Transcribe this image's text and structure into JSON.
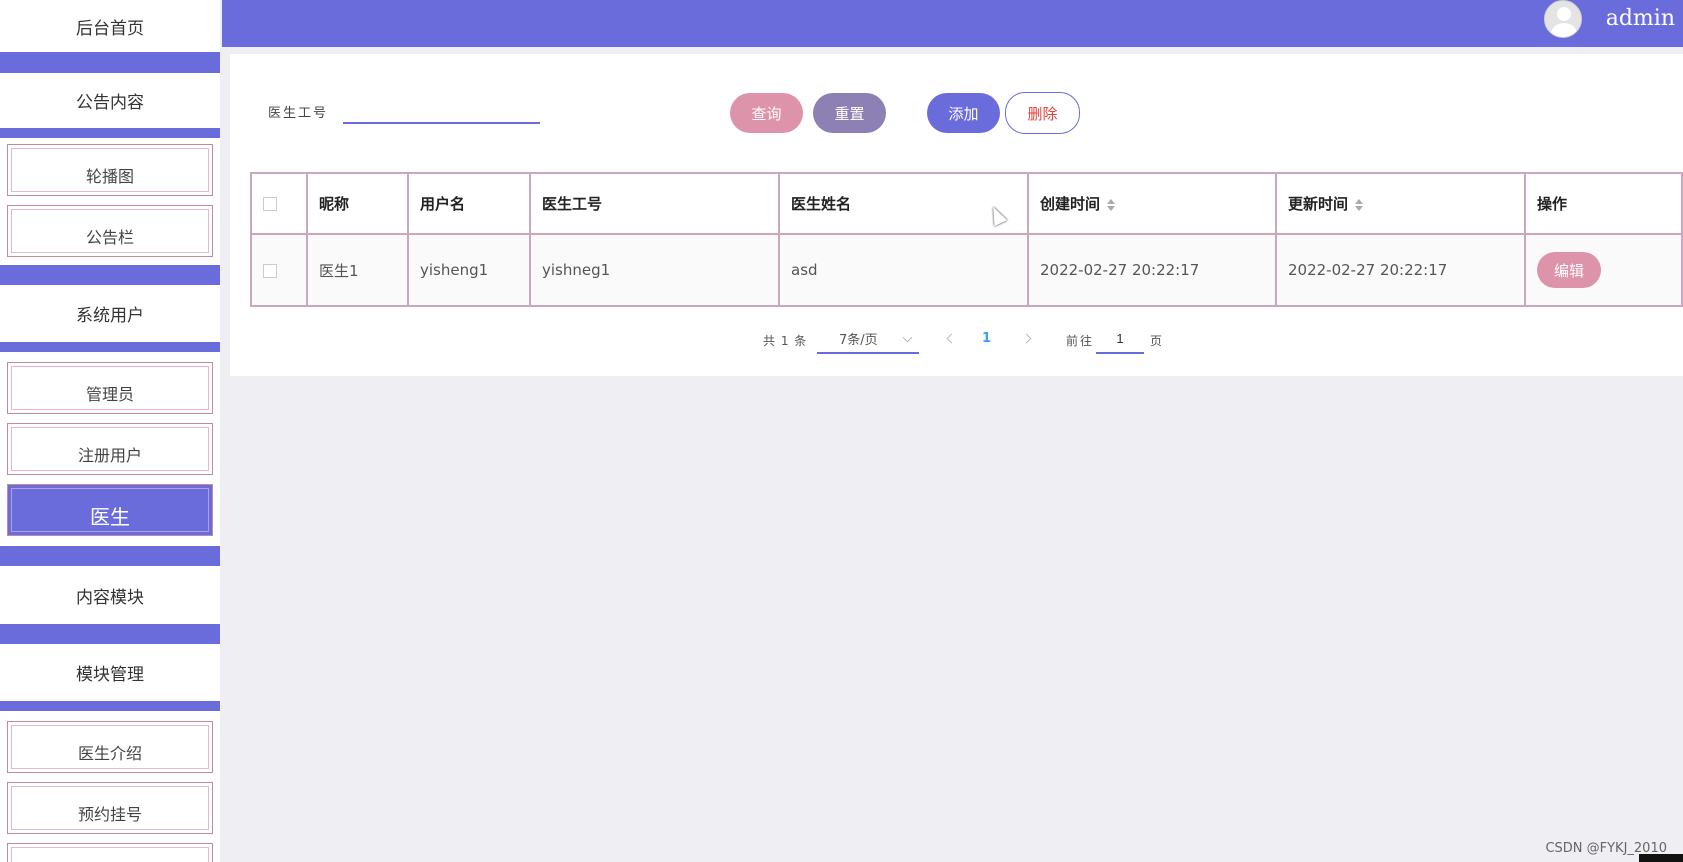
{
  "sidebar": {
    "home": "后台首页",
    "groups": [
      {
        "label": "公告内容",
        "items": [
          "轮播图",
          "公告栏"
        ]
      },
      {
        "label": "系统用户",
        "items": [
          "管理员",
          "注册用户",
          "医生"
        ]
      },
      {
        "label": "内容模块",
        "items": []
      },
      {
        "label": "模块管理",
        "items": [
          "医生介绍",
          "预约挂号"
        ]
      }
    ],
    "active_item": "医生"
  },
  "header": {
    "username": "admin"
  },
  "search": {
    "label": "医生工号",
    "value": ""
  },
  "buttons": {
    "query": "查询",
    "reset": "重置",
    "add": "添加",
    "delete": "删除"
  },
  "table": {
    "headers": [
      "昵称",
      "用户名",
      "医生工号",
      "医生姓名",
      "创建时间",
      "更新时间",
      "操作"
    ],
    "rows": [
      {
        "nickname": "医生1",
        "username": "yisheng1",
        "doctor_id": "yishneg1",
        "doctor_name": "asd",
        "created": "2022-02-27 20:22:17",
        "updated": "2022-02-27 20:22:17",
        "action": "编辑"
      }
    ]
  },
  "pagination": {
    "total": "共 1 条",
    "page_size": "7条/页",
    "current_page": "1",
    "goto_label": "前往",
    "goto_value": "1",
    "page_suffix": "页"
  },
  "watermark": "CSDN @FYKJ_2010",
  "colors": {
    "primary": "#6a6cdc",
    "pink": "#dd93aa",
    "purple_gray": "#8d80b4",
    "danger": "#e0423a"
  }
}
